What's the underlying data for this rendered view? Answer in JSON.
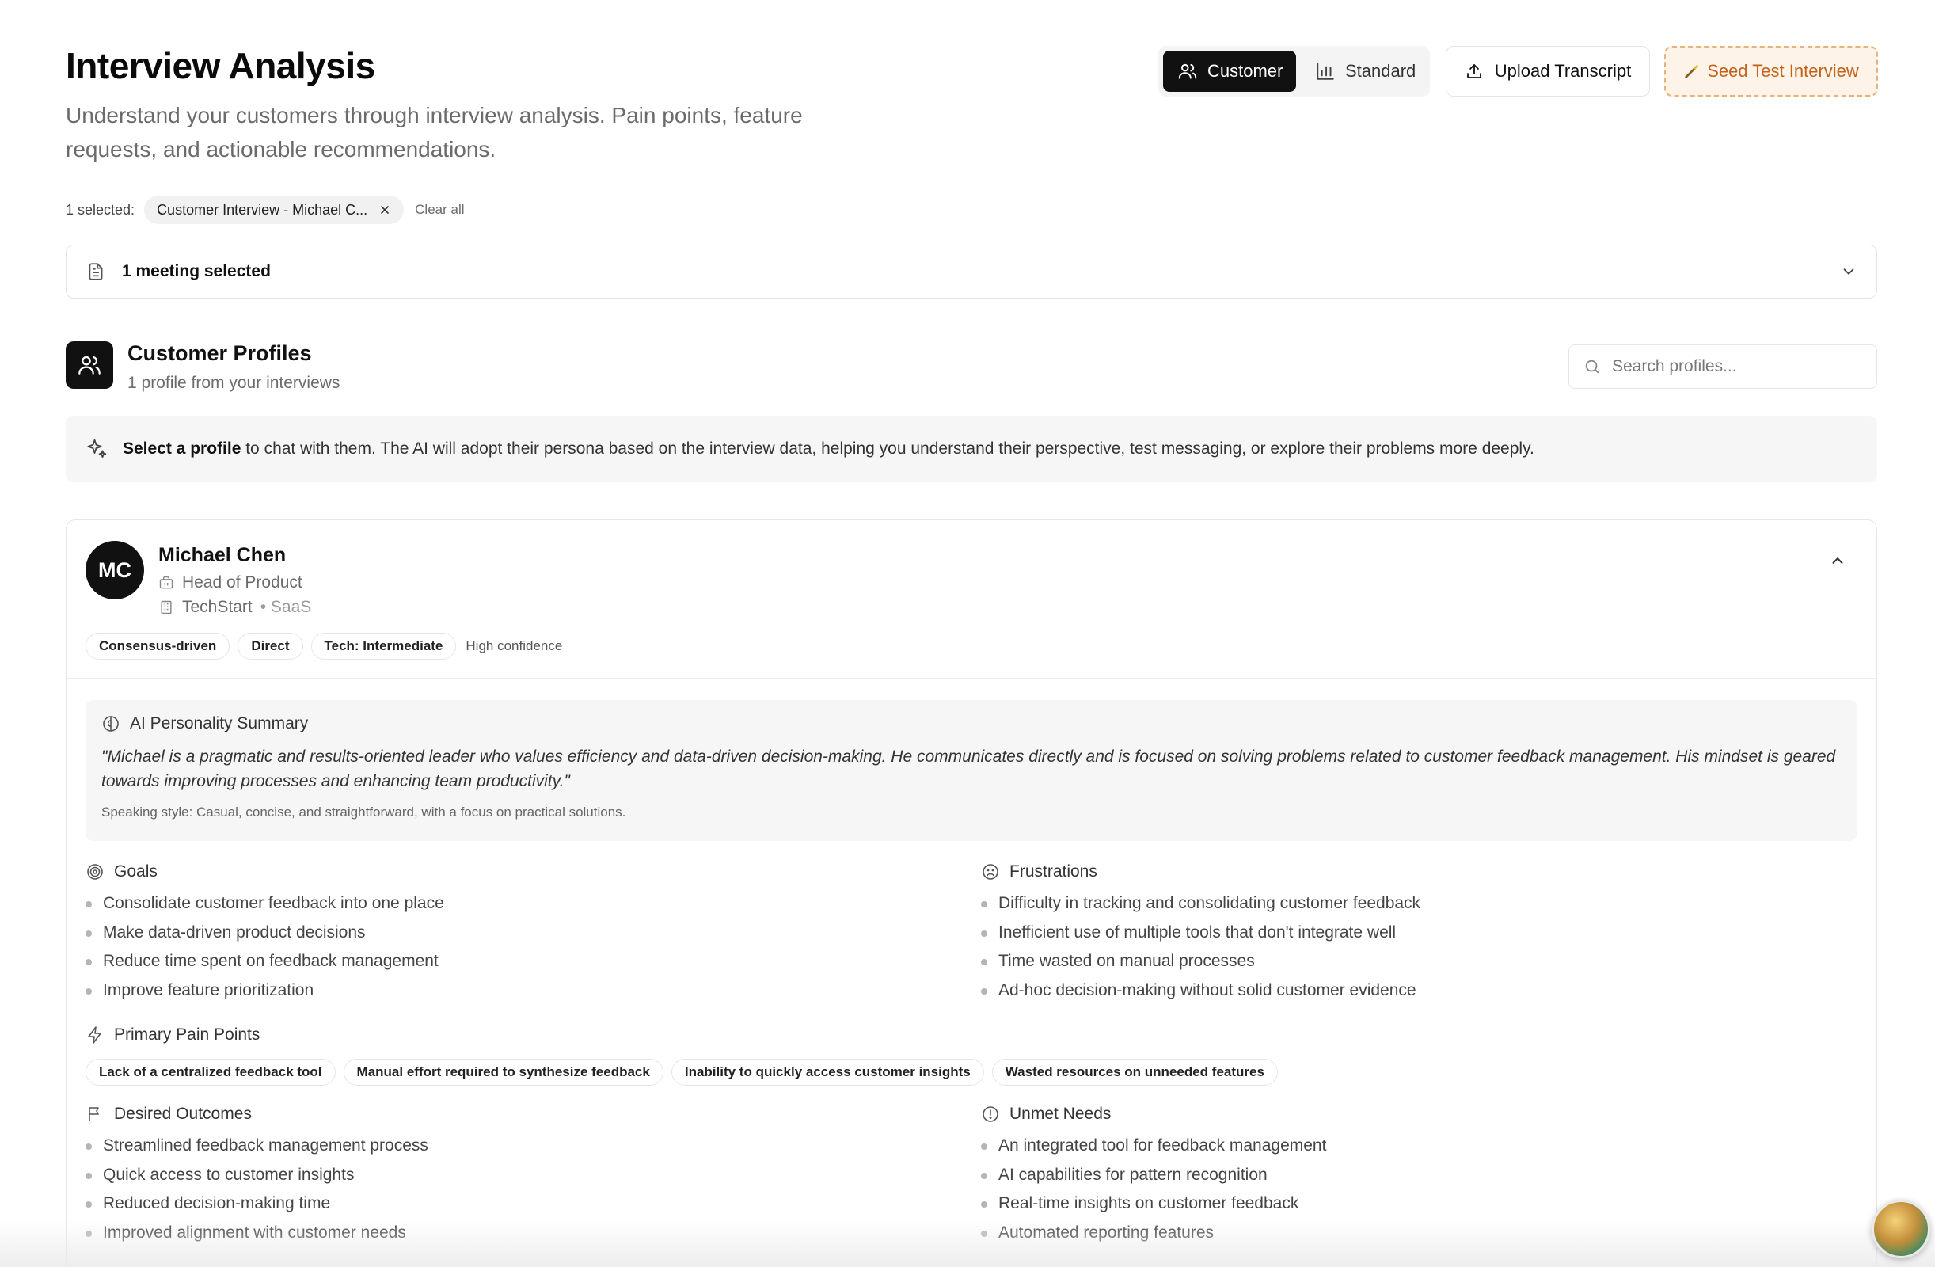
{
  "header": {
    "title": "Interview Analysis",
    "subtitle": "Understand your customers through interview analysis. Pain points, feature requests, and actionable recommendations."
  },
  "mode_toggle": {
    "customer_label": "Customer",
    "standard_label": "Standard",
    "active": "Customer"
  },
  "actions": {
    "upload_label": "Upload Transcript",
    "seed_label": "Seed Test Interview"
  },
  "selection": {
    "count_label": "1 selected:",
    "chip_label": "Customer Interview - Michael C...",
    "clear_label": "Clear all",
    "meeting_label": "1 meeting selected"
  },
  "profiles": {
    "title": "Customer Profiles",
    "subtitle": "1 profile from your interviews",
    "search_placeholder": "Search profiles...",
    "info_bold": "Select a profile",
    "info_rest": " to chat with them. The AI will adopt their persona based on the interview data, helping you understand their perspective, test messaging, or explore their problems more deeply."
  },
  "profile": {
    "initials": "MC",
    "name": "Michael Chen",
    "role": "Head of Product",
    "company": "TechStart",
    "industry": "• SaaS",
    "tags": [
      "Consensus-driven",
      "Direct",
      "Tech: Intermediate"
    ],
    "confidence": "High confidence",
    "summary_title": "AI Personality Summary",
    "summary_quote": "\"Michael is a pragmatic and results-oriented leader who values efficiency and data-driven decision-making. He communicates directly and is focused on solving problems related to customer feedback management. His mindset is geared towards improving processes and enhancing team productivity.\"",
    "speaking_style": "Speaking style: Casual, concise, and straightforward, with a focus on practical solutions.",
    "goals_title": "Goals",
    "goals": [
      "Consolidate customer feedback into one place",
      "Make data-driven product decisions",
      "Reduce time spent on feedback management",
      "Improve feature prioritization"
    ],
    "frustrations_title": "Frustrations",
    "frustrations": [
      "Difficulty in tracking and consolidating customer feedback",
      "Inefficient use of multiple tools that don't integrate well",
      "Time wasted on manual processes",
      "Ad-hoc decision-making without solid customer evidence"
    ],
    "pain_points_title": "Primary Pain Points",
    "pain_points": [
      "Lack of a centralized feedback tool",
      "Manual effort required to synthesize feedback",
      "Inability to quickly access customer insights",
      "Wasted resources on unneeded features"
    ],
    "outcomes_title": "Desired Outcomes",
    "outcomes": [
      "Streamlined feedback management process",
      "Quick access to customer insights",
      "Reduced decision-making time",
      "Improved alignment with customer needs"
    ],
    "unmet_title": "Unmet Needs",
    "unmet": [
      "An integrated tool for feedback management",
      "AI capabilities for pattern recognition",
      "Real-time insights on customer feedback",
      "Automated reporting features"
    ]
  }
}
